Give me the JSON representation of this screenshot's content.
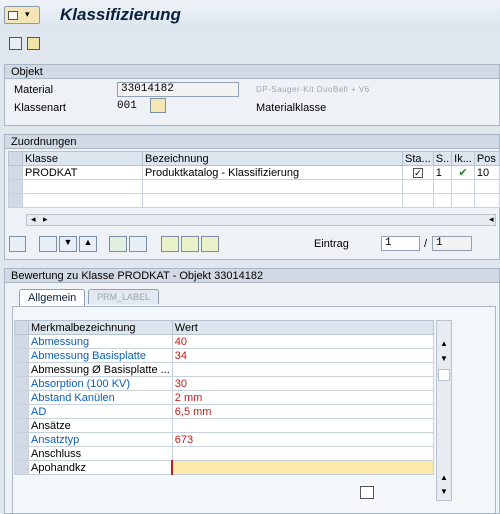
{
  "header": {
    "title": "Klassifizierung"
  },
  "objekt": {
    "section_title": "Objekt",
    "material_label": "Material",
    "material_value": "33014182",
    "material_desc": "DP-Sauger-Kit DuoBell + V6",
    "klassenart_label": "Klassenart",
    "klassenart_value": "001",
    "klassenart_desc": "Materialklasse"
  },
  "zuordnungen": {
    "section_title": "Zuordnungen",
    "columns": [
      "Klasse",
      "Bezeichnung",
      "Sta...",
      "S..",
      "Ik...",
      "Pos"
    ],
    "rows": [
      {
        "klasse": "PRODKAT",
        "bezeichnung": "Produktkatalog - Klassifizierung",
        "status_checked": true,
        "s": "1",
        "ik": "check",
        "pos": "10"
      }
    ],
    "eintrag_label": "Eintrag",
    "eintrag_current": "1",
    "eintrag_sep": "/",
    "eintrag_total": "1"
  },
  "bewertung": {
    "section_title": "Bewertung zu Klasse PRODKAT - Objekt 33014182",
    "tabs": [
      {
        "label": "Allgemein",
        "active": true
      },
      {
        "label": "PRM_LABEL",
        "active": false
      }
    ],
    "columns": [
      "Merkmalbezeichnung",
      "Wert"
    ],
    "rows": [
      {
        "name": "Abmessung",
        "value": "40",
        "name_color": "blue"
      },
      {
        "name": "Abmessung Basisplatte",
        "value": "34",
        "name_color": "blue"
      },
      {
        "name": "Abmessung Ø Basisplatte ...",
        "value": "",
        "name_color": "black"
      },
      {
        "name": "Absorption (100 KV)",
        "value": "30",
        "name_color": "blue"
      },
      {
        "name": "Abstand Kanülen",
        "value": "2 mm",
        "name_color": "blue"
      },
      {
        "name": "AD",
        "value": "6,5 mm",
        "name_color": "blue"
      },
      {
        "name": "Ansätze",
        "value": "",
        "name_color": "black"
      },
      {
        "name": "Ansatztyp",
        "value": "673",
        "name_color": "blue"
      },
      {
        "name": "Anschluss",
        "value": "",
        "name_color": "black"
      },
      {
        "name": "Apohandkz",
        "value": "",
        "name_color": "black"
      }
    ]
  },
  "colors": {
    "accent": "#0b5fb5",
    "value_red": "#c21d1d",
    "input_yellow": "#fde9a8"
  },
  "icons": [
    "menu-icon",
    "save-icon",
    "other-object-icon",
    "choose-class-icon",
    "details-icon",
    "find-icon",
    "down-icon",
    "up-icon",
    "insert-line-icon",
    "delete-line-icon",
    "values-icon",
    "value-assign-icon",
    "text-icon",
    "scroll-left-icon",
    "scroll-right-icon",
    "check-icon",
    "value-help-icon"
  ]
}
